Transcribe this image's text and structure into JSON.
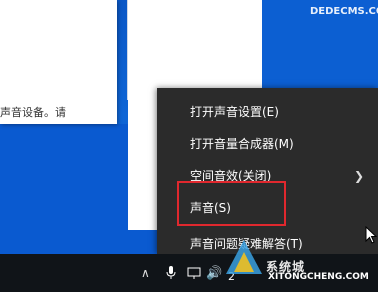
{
  "background_dialog": {
    "partial_text": "声音设备。请"
  },
  "watermark_top": "DEDECMS.COM",
  "context_menu": {
    "items": [
      {
        "label": "打开声音设置(E)",
        "has_submenu": false
      },
      {
        "label": "打开音量合成器(M)",
        "has_submenu": false
      },
      {
        "label": "空间音效(关闭)",
        "has_submenu": true
      },
      {
        "label": "声音(S)",
        "has_submenu": false,
        "highlighted": true
      },
      {
        "label": "声音问题疑难解答(T)",
        "has_submenu": false
      }
    ]
  },
  "taskbar": {
    "tray_time_partial": "2",
    "icons": [
      "chevron-up-icon",
      "microphone-icon",
      "network-icon",
      "volume-icon"
    ]
  },
  "logo": {
    "line1": "系统城",
    "line2": "XITONGCHENG.COM"
  },
  "colors": {
    "menu_bg": "#2b2b2b",
    "highlight_border": "#e0282e",
    "desktop_blue": "#0a57c6",
    "taskbar_bg": "#101418"
  }
}
